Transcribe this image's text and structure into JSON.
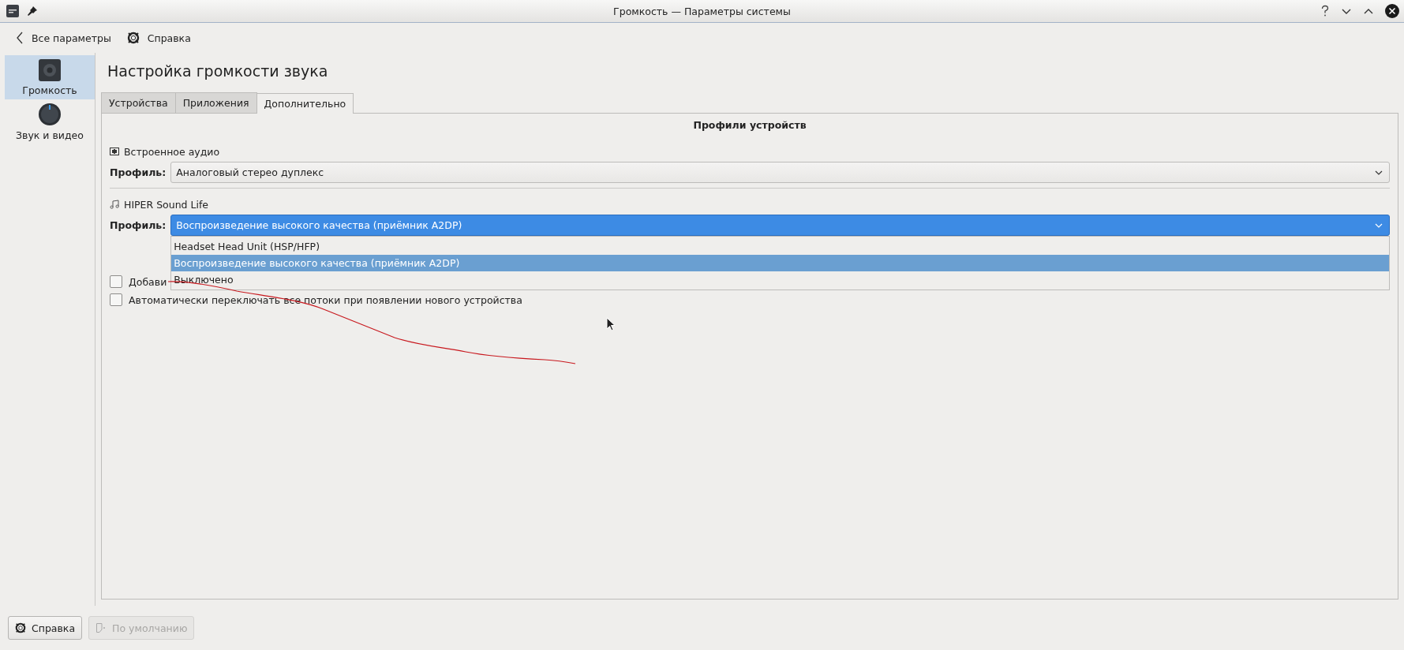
{
  "window": {
    "title": "Громкость — Параметры системы"
  },
  "toolbar": {
    "back": "Все параметры",
    "help": "Справка"
  },
  "sidebar": {
    "items": [
      {
        "label": "Громкость",
        "selected": true,
        "kind": "speaker"
      },
      {
        "label": "Звук и видео",
        "selected": false,
        "kind": "knob"
      }
    ]
  },
  "page": {
    "title": "Настройка громкости звука"
  },
  "tabs": [
    {
      "label": "Устройства",
      "selected": false
    },
    {
      "label": "Приложения",
      "selected": false
    },
    {
      "label": "Дополнительно",
      "selected": true
    }
  ],
  "section_title": "Профили устройств",
  "devices": [
    {
      "name": "Встроенное аудио",
      "kind": "card",
      "profile_label": "Профиль:",
      "profile": "Аналоговый стерео дуплекс",
      "open": false
    },
    {
      "name": "HIPER Sound Life",
      "kind": "music",
      "profile_label": "Профиль:",
      "profile": "Воспроизведение высокого качества (приёмник A2DP)",
      "open": true,
      "options": [
        {
          "label": "Headset Head Unit (HSP/HFP)",
          "selected": false
        },
        {
          "label": "Воспроизведение высокого качества (приёмник A2DP)",
          "selected": true
        },
        {
          "label": "Выключено",
          "selected": false
        }
      ]
    }
  ],
  "checkboxes": [
    {
      "label": "Добави",
      "checked": false
    },
    {
      "label": "Автоматически переключать все потоки при появлении нового устройства",
      "checked": false
    }
  ],
  "footer": {
    "buttons": [
      {
        "label": "Справка",
        "kind": "help",
        "disabled": false
      },
      {
        "label": "По умолчанию",
        "kind": "defaults",
        "disabled": true
      }
    ]
  }
}
